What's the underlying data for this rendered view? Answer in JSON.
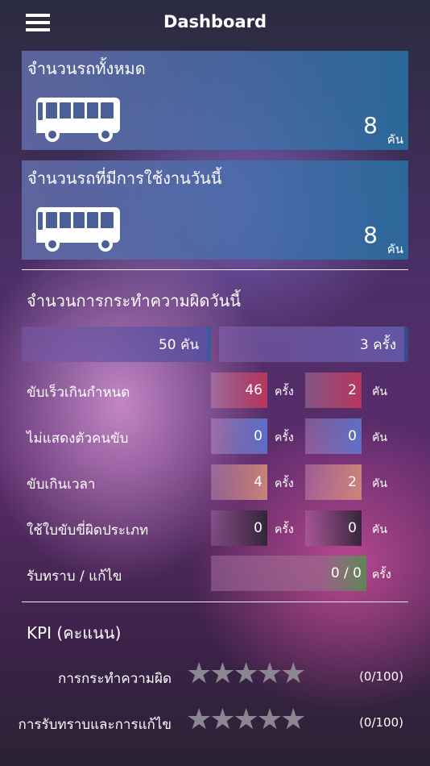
{
  "header": {
    "title": "Dashboard"
  },
  "cards": [
    {
      "label": "จำนวนรถทั้งหมด",
      "count": "8",
      "unit": "คัน"
    },
    {
      "label": "จำนวนรถที่มีการใช้งานวันนี้",
      "count": "8",
      "unit": "คัน"
    }
  ],
  "violations": {
    "title": "จำนวนการกระทำความผิดวันนี้",
    "summary": {
      "vehicles": "50 คัน",
      "times": "3 ครั้ง"
    },
    "times_unit": "ครั้ง",
    "vehicle_unit": "คัน",
    "rows": [
      {
        "label": "ขับเร็วเกินกำหนด",
        "times": "46",
        "vehicles": "2",
        "accent": "#c8385a"
      },
      {
        "label": "ไม่แสดงตัวคนขับ",
        "times": "0",
        "vehicles": "0",
        "accent": "#5c7ad8"
      },
      {
        "label": "ขับเกินเวลา",
        "times": "4",
        "vehicles": "2",
        "accent": "#d8907a"
      },
      {
        "label": "ใช้ใบขับขี่ผิดประเภท",
        "times": "0",
        "vehicles": "0",
        "accent": "#2a2232"
      }
    ],
    "ack": {
      "label": "รับทราบ / แก้ไข",
      "value": "0 / 0",
      "unit": "ครั้ง",
      "accent": "#5a8a54"
    }
  },
  "kpi": {
    "title": "KPI (คะแนน)",
    "items": [
      {
        "label": "การกระทำความผิด",
        "stars": 5,
        "score": "(0/100)"
      },
      {
        "label": "การรับทราบและการแก้ไข",
        "stars": 5,
        "score": "(0/100)"
      }
    ]
  }
}
